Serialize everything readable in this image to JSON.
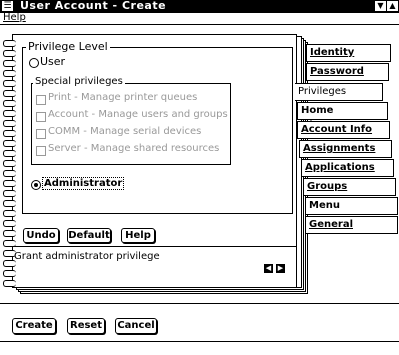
{
  "window": {
    "title": "User Account - Create",
    "sysmenu_icon": "system-menu-icon",
    "minimize_icon": "minimize-icon",
    "maximize_icon": "maximize-icon"
  },
  "menu": {
    "help": "Help"
  },
  "privilege": {
    "group_label": "Privilege Level",
    "user_label": "User",
    "special_label": "Special privileges",
    "special_items": [
      "Print - Manage printer queues",
      "Account - Manage users and groups",
      "COMM - Manage serial devices",
      "Server - Manage shared resources"
    ],
    "admin_label": "Administrator",
    "selected": "Administrator"
  },
  "buttons": {
    "undo": "Undo",
    "default": "Default",
    "help": "Help"
  },
  "status": "Grant administrator privilege",
  "tabs": [
    "Identity",
    "Password",
    "Privileges",
    "Home Directory",
    "Account Info",
    "Assignments",
    "Applications",
    "Groups",
    "Menu",
    "General"
  ],
  "bottom_buttons": {
    "create": "Create",
    "reset": "Reset",
    "cancel": "Cancel"
  }
}
